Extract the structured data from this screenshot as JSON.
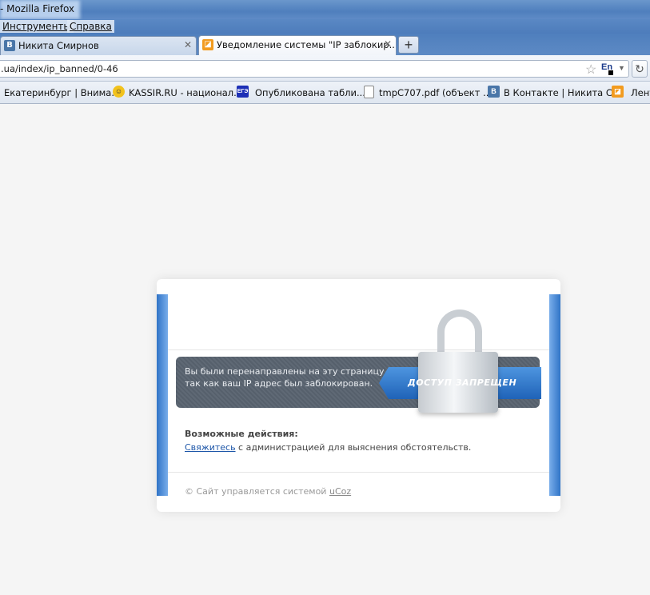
{
  "window": {
    "title": "- Mozilla Firefox"
  },
  "menu": {
    "items": [
      "Инструменты",
      "Справка"
    ]
  },
  "tabs": [
    {
      "label": "Никита Смирнов",
      "icon": "vk-icon",
      "close": "✕"
    },
    {
      "label": "Уведомление системы \"IP заблокир...",
      "icon": "ucoz-icon",
      "close": "✕"
    }
  ],
  "newtab": {
    "label": "+"
  },
  "navbar": {
    "url": ".ua/index/ip_banned/0-46",
    "lang": "En"
  },
  "bookmarks": [
    {
      "label": "Екатеринбург | Внима...",
      "icon": "none"
    },
    {
      "label": "KASSIR.RU - национал...",
      "icon": "kassir-icon"
    },
    {
      "label": "Опубликована табли...",
      "icon": "ege-icon",
      "icon_text": "ЕГЭ"
    },
    {
      "label": "tmpC707.pdf (объект ...",
      "icon": "document-icon"
    },
    {
      "label": "В Контакте | Никита С...",
      "icon": "vk-icon",
      "icon_text": "B"
    },
    {
      "label": "Лент",
      "icon": "rss-icon"
    }
  ],
  "page": {
    "message_line1": "Вы были перенаправлены на эту страницу,",
    "message_line2": "так как ваш IP адрес был заблокирован.",
    "denied_label": "ДОСТУП ЗАПРЕЩЕН",
    "actions_title": "Возможные действия:",
    "contact_link": "Свяжитесь",
    "contact_rest": " с администрацией для выяснения обстоятельств.",
    "footer_text": "© Сайт управляется системой ",
    "footer_link": "uCoz"
  },
  "colors": {
    "accent_blue": "#2f74c7",
    "banner_gray": "#5f6975",
    "link": "#1c55a8"
  }
}
